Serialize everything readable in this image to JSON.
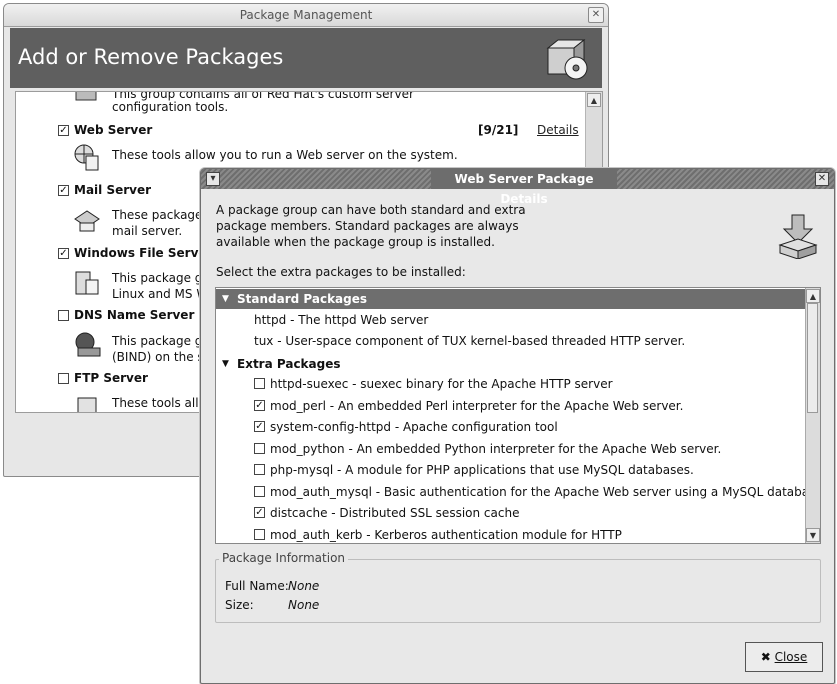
{
  "back_window": {
    "title": "Package Management",
    "banner_title": "Add or Remove Packages",
    "top_partial_desc": "This group contains all of Red Hat's custom server",
    "top_partial_desc2": "configuration tools.",
    "groups": [
      {
        "name": "Web Server",
        "checked": true,
        "count": "[9/21]",
        "details": "Details",
        "desc1": "These tools allow you to run a Web server on the system.",
        "desc2": ""
      },
      {
        "name": "Mail Server",
        "checked": true,
        "desc1": "These packages",
        "desc2": "mail server."
      },
      {
        "name": "Windows File Server",
        "checked": true,
        "desc1": "This package grou",
        "desc2": "Linux and MS Wi"
      },
      {
        "name": "DNS Name Server",
        "checked": false,
        "desc1": "This package grou",
        "desc2": "(BIND) on the sys"
      },
      {
        "name": "FTP Server",
        "checked": false,
        "desc1": "These tools allow",
        "desc2": ""
      }
    ]
  },
  "dialog": {
    "title": "Web Server Package Details",
    "intro": "A package group can have both standard and extra package members.  Standard packages are always available when the package group is installed.",
    "select_label": "Select the extra packages to be installed:",
    "standard_header": "Standard Packages",
    "standard_packages": [
      "httpd - The httpd Web server",
      "tux - User-space component of TUX kernel-based threaded HTTP server."
    ],
    "extra_header": "Extra Packages",
    "extra_packages": [
      {
        "text": "httpd-suexec - suexec binary for the Apache HTTP server",
        "checked": false
      },
      {
        "text": "mod_perl - An embedded Perl interpreter for the Apache Web server.",
        "checked": true
      },
      {
        "text": "system-config-httpd - Apache configuration tool",
        "checked": true
      },
      {
        "text": "mod_python - An embedded Python interpreter for the Apache Web server.",
        "checked": false
      },
      {
        "text": "php-mysql - A module for PHP applications that use MySQL databases.",
        "checked": false
      },
      {
        "text": "mod_auth_mysql - Basic authentication for the Apache Web server using a MySQL database.",
        "checked": false
      },
      {
        "text": "distcache - Distributed SSL session cache",
        "checked": true
      },
      {
        "text": "mod_auth_kerb - Kerberos authentication module for HTTP",
        "checked": false
      }
    ],
    "info_legend": "Package Information",
    "full_name_label": "Full Name:",
    "full_name_value": "None",
    "size_label": "Size:",
    "size_value": "None",
    "close_label": "Close",
    "close_icon": "x-icon"
  }
}
